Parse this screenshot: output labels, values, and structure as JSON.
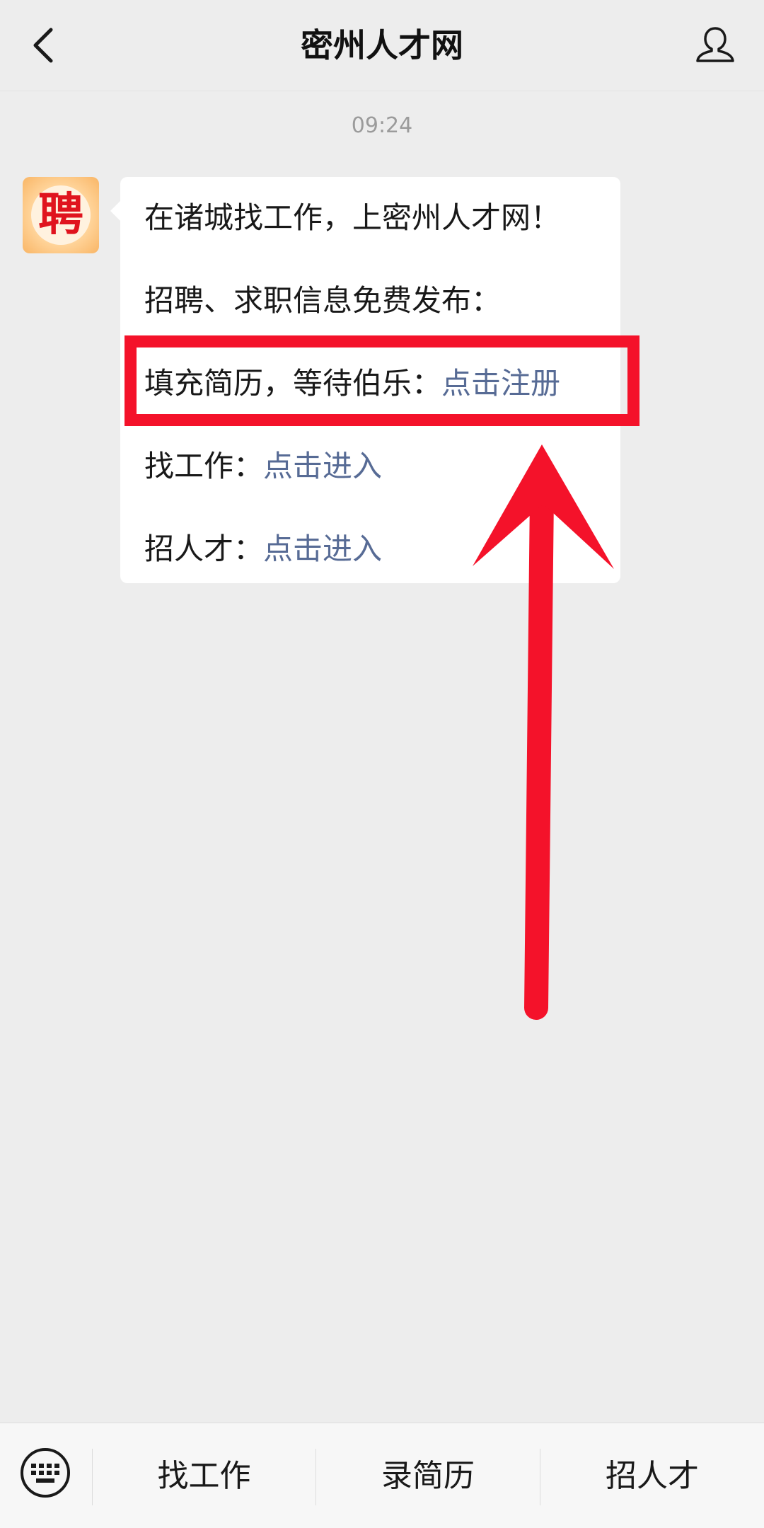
{
  "header": {
    "title": "密州人才网",
    "back_icon": "chevron-left-icon",
    "profile_icon": "person-icon"
  },
  "chat": {
    "timestamp": "09:24",
    "avatar_char": "聘",
    "message": {
      "line1": "在诸城找工作，上密州人才网！",
      "line2": "招聘、求职信息免费发布：",
      "line3_text": "填充简历，等待伯乐：",
      "line3_link": "点击注册",
      "line4_text": "找工作：",
      "line4_link": "点击进入",
      "line5_text": "招人才：",
      "line5_link": "点击进入"
    }
  },
  "bottom_menu": {
    "keyboard_icon": "keyboard-icon",
    "items": [
      {
        "label": "找工作"
      },
      {
        "label": "录简历"
      },
      {
        "label": "招人才"
      }
    ]
  },
  "colors": {
    "link": "#576b95",
    "annotation": "#f4122a",
    "background": "#ededed"
  }
}
